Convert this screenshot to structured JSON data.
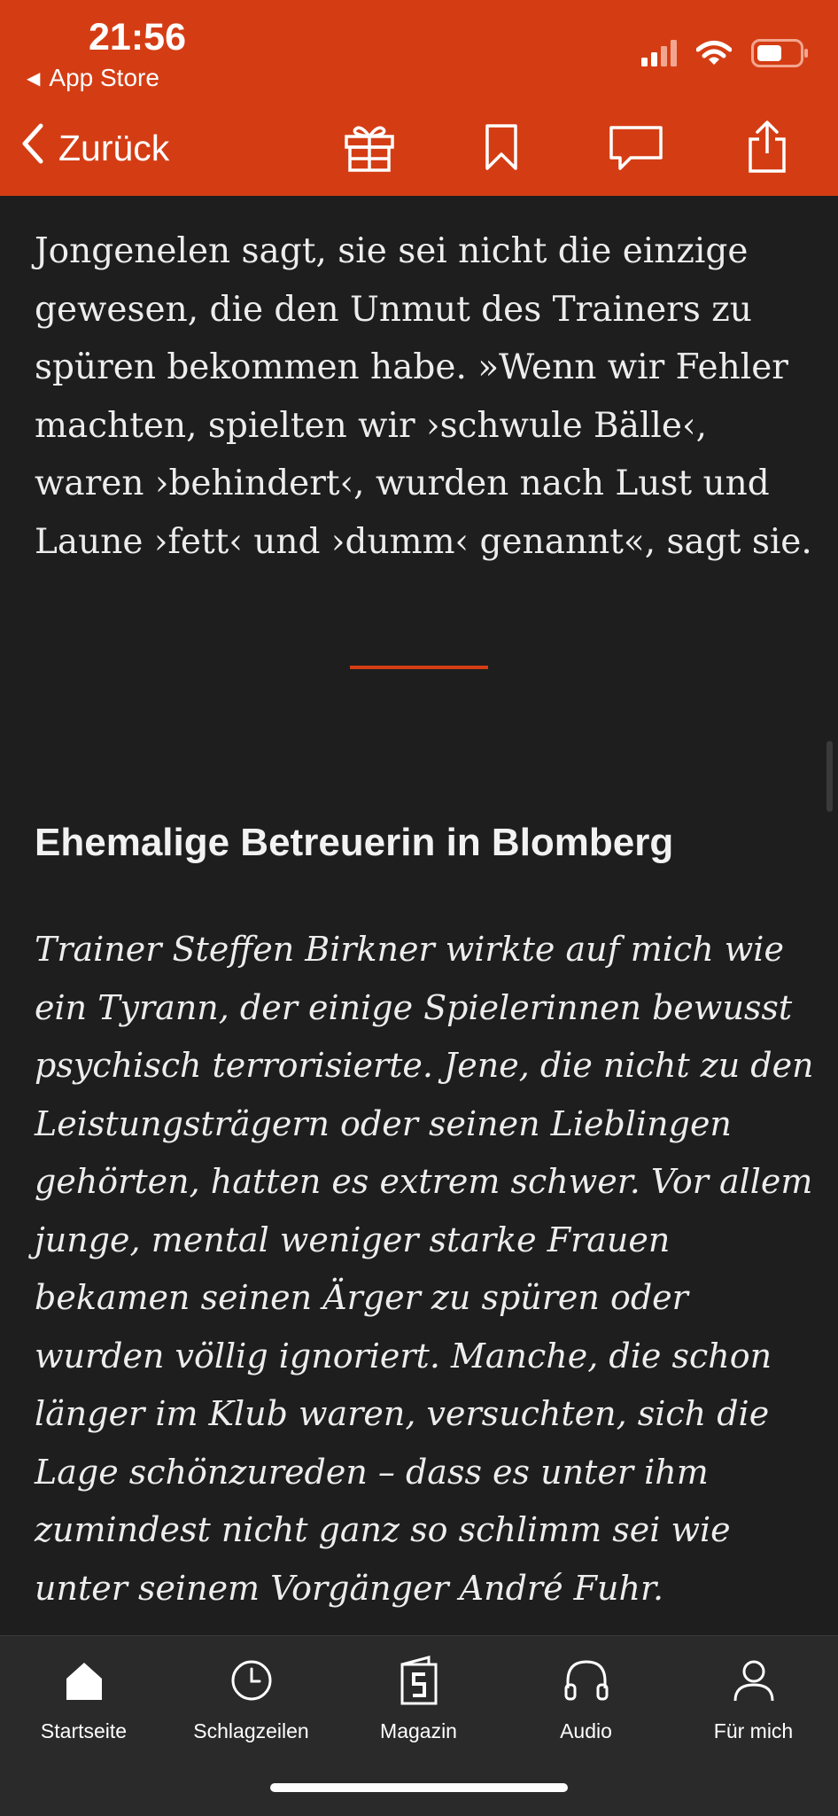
{
  "status_bar": {
    "time": "21:56",
    "back_app_label": "App Store",
    "icons": [
      "signal-icon",
      "wifi-icon",
      "battery-icon"
    ]
  },
  "nav_bar": {
    "back_label": "Zurück",
    "actions": [
      "gift-icon",
      "bookmark-icon",
      "comment-icon",
      "share-icon"
    ]
  },
  "article": {
    "paragraph_1": "Jongenelen sagt, sie sei nicht die einzige gewesen, die den Unmut des Trainers zu spüren bekommen habe. »Wenn wir Fehler machten, spielten wir ›schwule Bälle‹, waren ›behindert‹, wurden nach Lust und Laune ›fett‹ und ›dumm‹ genannt«, sagt sie.",
    "subheading": "Ehemalige Betreuerin in Blomberg",
    "quote": "Trainer Steffen Birkner wirkte auf mich wie ein Tyrann, der einige Spielerinnen bewusst psychisch terrorisierte. Jene, die nicht zu den Leistungsträgern oder seinen Lieblingen gehörten, hatten es extrem schwer. Vor allem junge, mental weniger starke Frauen bekamen seinen Ärger zu spüren oder wurden völlig ignoriert. Manche, die schon länger im Klub waren, versuchten, sich die Lage schönzureden – dass es unter ihm zumindest nicht ganz so schlimm sei wie unter seinem Vorgänger André Fuhr."
  },
  "tab_bar": {
    "tabs": [
      {
        "label": "Startseite",
        "icon": "home-icon"
      },
      {
        "label": "Schlagzeilen",
        "icon": "clock-icon"
      },
      {
        "label": "Magazin",
        "icon": "magazine-icon"
      },
      {
        "label": "Audio",
        "icon": "headphones-icon"
      },
      {
        "label": "Für mich",
        "icon": "person-icon"
      }
    ]
  },
  "colors": {
    "brand_orange": "#d43d14",
    "background": "#1e1e1e",
    "tab_bar": "#2a2a2a"
  }
}
